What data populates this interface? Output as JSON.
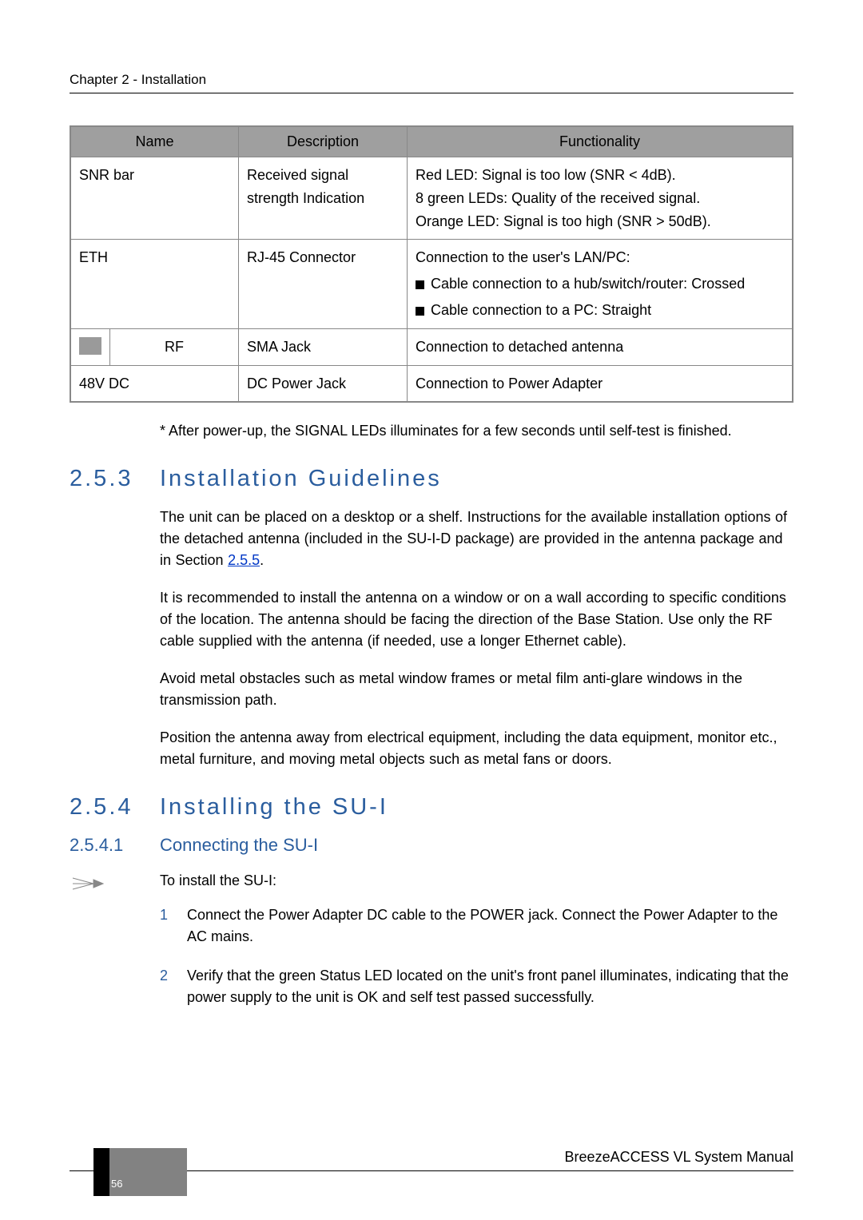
{
  "header": {
    "chapter": "Chapter 2 - Installation"
  },
  "table": {
    "headers": {
      "name": "Name",
      "description": "Description",
      "functionality": "Functionality"
    },
    "rows": {
      "snr": {
        "name": "SNR bar",
        "desc": "Received signal strength Indication",
        "func_l1": "Red LED: Signal is too low (SNR < 4dB).",
        "func_l2": "8 green LEDs: Quality of the received signal.",
        "func_l3": "Orange LED: Signal is too high (SNR > 50dB)."
      },
      "eth": {
        "name": "ETH",
        "desc": "RJ-45 Connector",
        "func_intro": "Connection to the user's LAN/PC:",
        "func_b1": "Cable connection to a hub/switch/router: Crossed",
        "func_b2": "Cable connection to a PC: Straight"
      },
      "rf": {
        "name": "RF",
        "desc": "SMA Jack",
        "func": "Connection to detached antenna"
      },
      "dc": {
        "name": "48V DC",
        "desc": "DC Power Jack",
        "func": "Connection to Power Adapter"
      }
    }
  },
  "footnote": "* After power-up, the SIGNAL LEDs illuminates for a few seconds until self-test is finished.",
  "s253": {
    "num": "2.5.3",
    "title": "Installation Guidelines",
    "p1a": "The unit can be placed on a desktop or a shelf. Instructions for the available installation options of the detached antenna (included in the SU-I-D package) are provided in the antenna package and in Section ",
    "p1link": "2.5.5",
    "p1b": ".",
    "p2": "It is recommended to install the antenna on a window or on a wall according to specific conditions of the location. The antenna should be facing the direction of the Base Station. Use only the RF cable supplied with the antenna (if needed, use a longer Ethernet cable).",
    "p3": "Avoid metal obstacles such as metal window frames or metal film anti-glare windows in the transmission path.",
    "p4": "Position the antenna away from electrical equipment, including the data equipment, monitor etc., metal furniture, and moving metal objects such as metal fans or doors."
  },
  "s254": {
    "num": "2.5.4",
    "title": "Installing the SU-I"
  },
  "s2541": {
    "num": "2.5.4.1",
    "title": "Connecting the SU-I",
    "intro": "To install the SU-I:",
    "steps": {
      "n1": "1",
      "t1": "Connect the Power Adapter DC cable to the POWER jack. Connect the Power Adapter to the AC mains.",
      "n2": "2",
      "t2": "Verify that the green Status LED located on the unit's front panel illuminates, indicating that the power supply to the unit is OK and self test passed successfully."
    }
  },
  "footer": {
    "manual": "BreezeACCESS VL System Manual",
    "page": "56"
  }
}
